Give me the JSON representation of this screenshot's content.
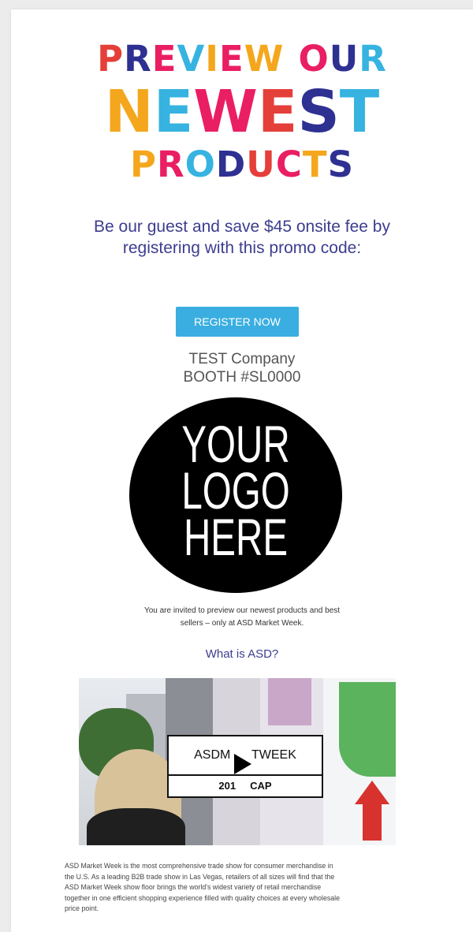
{
  "headline": {
    "line1": [
      {
        "text": "P",
        "color": "#e53f3a"
      },
      {
        "text": "R",
        "color": "#2e3092"
      },
      {
        "text": "E",
        "color": "#ea1e63"
      },
      {
        "text": "V",
        "color": "#36b3e0"
      },
      {
        "text": "I",
        "color": "#f4a71d"
      },
      {
        "text": "E",
        "color": "#ea1e63"
      },
      {
        "text": "W",
        "color": "#f4a71d"
      },
      {
        "text": "O",
        "color": "#ea1e63"
      },
      {
        "text": "U",
        "color": "#2e3092"
      },
      {
        "text": "R",
        "color": "#36b3e0"
      }
    ],
    "line2": [
      {
        "text": "N",
        "color": "#f4a71d"
      },
      {
        "text": "E",
        "color": "#36b3e0"
      },
      {
        "text": "W",
        "color": "#ea1e63"
      },
      {
        "text": "E",
        "color": "#e53f3a"
      },
      {
        "text": "S",
        "color": "#2e3092"
      },
      {
        "text": "T",
        "color": "#36b3e0"
      }
    ],
    "line3": [
      {
        "text": "P",
        "color": "#f4a71d"
      },
      {
        "text": "R",
        "color": "#ea1e63"
      },
      {
        "text": "O",
        "color": "#36b3e0"
      },
      {
        "text": "D",
        "color": "#2e3092"
      },
      {
        "text": "U",
        "color": "#e53f3a"
      },
      {
        "text": "C",
        "color": "#ea1e63"
      },
      {
        "text": "T",
        "color": "#f4a71d"
      },
      {
        "text": "S",
        "color": "#2e3092"
      }
    ]
  },
  "tagline": {
    "line1": "Be our guest and save $45 onsite fee by",
    "line2": "registering with this promo code:"
  },
  "register_button": {
    "label": "REGISTER NOW",
    "color": "#3aaee0"
  },
  "company": {
    "name": "TEST Company",
    "booth": "BOOTH #SL0000"
  },
  "logo": {
    "line1": "YOUR",
    "line2": "LOGO",
    "line3": "HERE"
  },
  "invite": {
    "line1": "You are invited to preview our newest products and best",
    "line2": "sellers – only at ASD Market Week."
  },
  "what_link": {
    "label": "What is ASD?"
  },
  "video": {
    "title_left": "ASDM",
    "title_right": "TWEEK",
    "subtitle_left": "201",
    "subtitle_right": "CAP"
  },
  "body_text": {
    "line1": "ASD Market Week is the most comprehensive trade show for consumer merchandise in",
    "line2": "the U.S. As a leading B2B trade show in Las Vegas, retailers of all sizes will find that the",
    "line3": "ASD Market Week show floor brings the world's widest variety of retail merchandise",
    "line4": "together in one efficient shopping experience filled with quality choices at every wholesale",
    "line5": "price point."
  }
}
